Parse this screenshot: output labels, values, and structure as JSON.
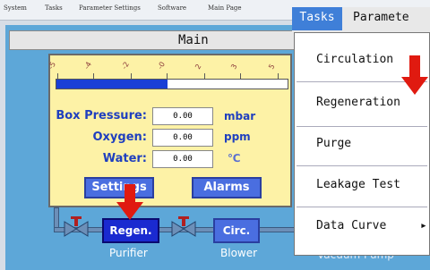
{
  "menubar": {
    "items": [
      "System",
      "Tasks",
      "Parameter Settings",
      "Software",
      "Main Page"
    ]
  },
  "main": {
    "title": "Main",
    "scale_ticks": [
      "-5",
      "-4",
      "-2",
      "-0",
      "2",
      "3",
      "5"
    ],
    "bar_level": 0.48,
    "fields": [
      {
        "label": "Box Pressure:",
        "value": "0.00",
        "unit": "mbar"
      },
      {
        "label": "Oxygen:",
        "value": "0.00",
        "unit": "ppm"
      },
      {
        "label": "Water:",
        "value": "0.00",
        "unit": "℃"
      }
    ],
    "settings_label": "Settings",
    "alarms_label": "Alarms"
  },
  "process": {
    "regen_label": "Regen.",
    "circ_label": "Circ.",
    "purifier_caption": "Purifier",
    "blower_caption": "Blower",
    "vacuum_caption": "Vacuum Pump"
  },
  "tasks_menu": {
    "tasks_tab": "Tasks",
    "param_tab": "Paramete",
    "items": [
      "Circulation",
      "Regeneration",
      "Purge",
      "Leakage Test",
      "Data Curve"
    ],
    "submenu_arrow": "▸"
  },
  "colors": {
    "screen_bg": "#5da7d8",
    "panel_bg": "#fdf2a6",
    "arrow": "#e01a10",
    "active_button": "#1a2ad0"
  }
}
